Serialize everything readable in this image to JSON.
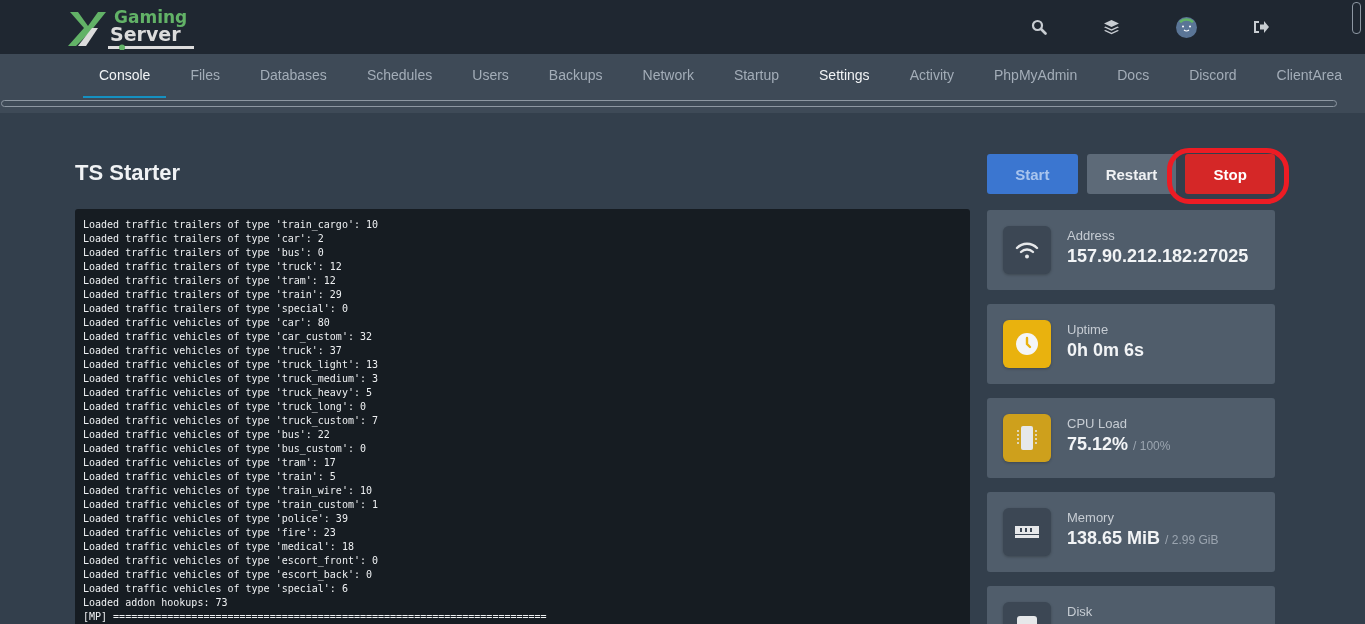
{
  "logo": {
    "line_1": "Gaming",
    "line_2": "Server"
  },
  "header_icons": [
    {
      "kind": "search"
    },
    {
      "kind": "layers"
    },
    {
      "kind": "avatar"
    },
    {
      "kind": "logout"
    }
  ],
  "tabs": [
    {
      "label": "Console",
      "selected": true,
      "hovered": false
    },
    {
      "label": "Files",
      "selected": false,
      "hovered": false
    },
    {
      "label": "Databases",
      "selected": false,
      "hovered": false
    },
    {
      "label": "Schedules",
      "selected": false,
      "hovered": false
    },
    {
      "label": "Users",
      "selected": false,
      "hovered": false
    },
    {
      "label": "Backups",
      "selected": false,
      "hovered": false
    },
    {
      "label": "Network",
      "selected": false,
      "hovered": false
    },
    {
      "label": "Startup",
      "selected": false,
      "hovered": false
    },
    {
      "label": "Settings",
      "selected": false,
      "hovered": true
    },
    {
      "label": "Activity",
      "selected": false,
      "hovered": false
    },
    {
      "label": "PhpMyAdmin",
      "selected": false,
      "hovered": false
    },
    {
      "label": "Docs",
      "selected": false,
      "hovered": false
    },
    {
      "label": "Discord",
      "selected": false,
      "hovered": false
    },
    {
      "label": "ClientArea",
      "selected": false,
      "hovered": false
    }
  ],
  "server_name": "TS Starter",
  "power_buttons": [
    {
      "label": "Start",
      "kind": "start",
      "highlighted": false
    },
    {
      "label": "Restart",
      "kind": "restart",
      "highlighted": false
    },
    {
      "label": "Stop",
      "kind": "stop",
      "highlighted": true
    }
  ],
  "console_lines": [
    "Loaded traffic trailers of type 'train_cargo': 10",
    "Loaded traffic trailers of type 'car': 2",
    "Loaded traffic trailers of type 'bus': 0",
    "Loaded traffic trailers of type 'truck': 12",
    "Loaded traffic trailers of type 'tram': 12",
    "Loaded traffic trailers of type 'train': 29",
    "Loaded traffic trailers of type 'special': 0",
    "Loaded traffic vehicles of type 'car': 80",
    "Loaded traffic vehicles of type 'car_custom': 32",
    "Loaded traffic vehicles of type 'truck': 37",
    "Loaded traffic vehicles of type 'truck_light': 13",
    "Loaded traffic vehicles of type 'truck_medium': 3",
    "Loaded traffic vehicles of type 'truck_heavy': 5",
    "Loaded traffic vehicles of type 'truck_long': 0",
    "Loaded traffic vehicles of type 'truck_custom': 7",
    "Loaded traffic vehicles of type 'bus': 22",
    "Loaded traffic vehicles of type 'bus_custom': 0",
    "Loaded traffic vehicles of type 'tram': 17",
    "Loaded traffic vehicles of type 'train': 5",
    "Loaded traffic vehicles of type 'train_wire': 10",
    "Loaded traffic vehicles of type 'train_custom': 1",
    "Loaded traffic vehicles of type 'police': 39",
    "Loaded traffic vehicles of type 'fire': 23",
    "Loaded traffic vehicles of type 'medical': 18",
    "Loaded traffic vehicles of type 'escort_front': 0",
    "Loaded traffic vehicles of type 'escort_back': 0",
    "Loaded traffic vehicles of type 'special': 6",
    "Loaded addon hookups: 73",
    "[MP] ========================================================================"
  ],
  "stats": [
    {
      "kind": "address",
      "label": "Address",
      "value": "157.90.212.182:27025",
      "color": "#3c4754"
    },
    {
      "kind": "uptime",
      "label": "Uptime",
      "value": "0h 0m 6s",
      "color": "#e9b20e"
    },
    {
      "kind": "cpu",
      "label": "CPU Load",
      "value": "75.12%",
      "limit": "/ 100%",
      "color": "#cea01c"
    },
    {
      "kind": "memory",
      "label": "Memory",
      "value": "138.65 MiB",
      "limit": "/ 2.99 GiB",
      "color": "#3c4754"
    },
    {
      "kind": "disk",
      "label": "Disk",
      "color": "#3c4754"
    }
  ]
}
